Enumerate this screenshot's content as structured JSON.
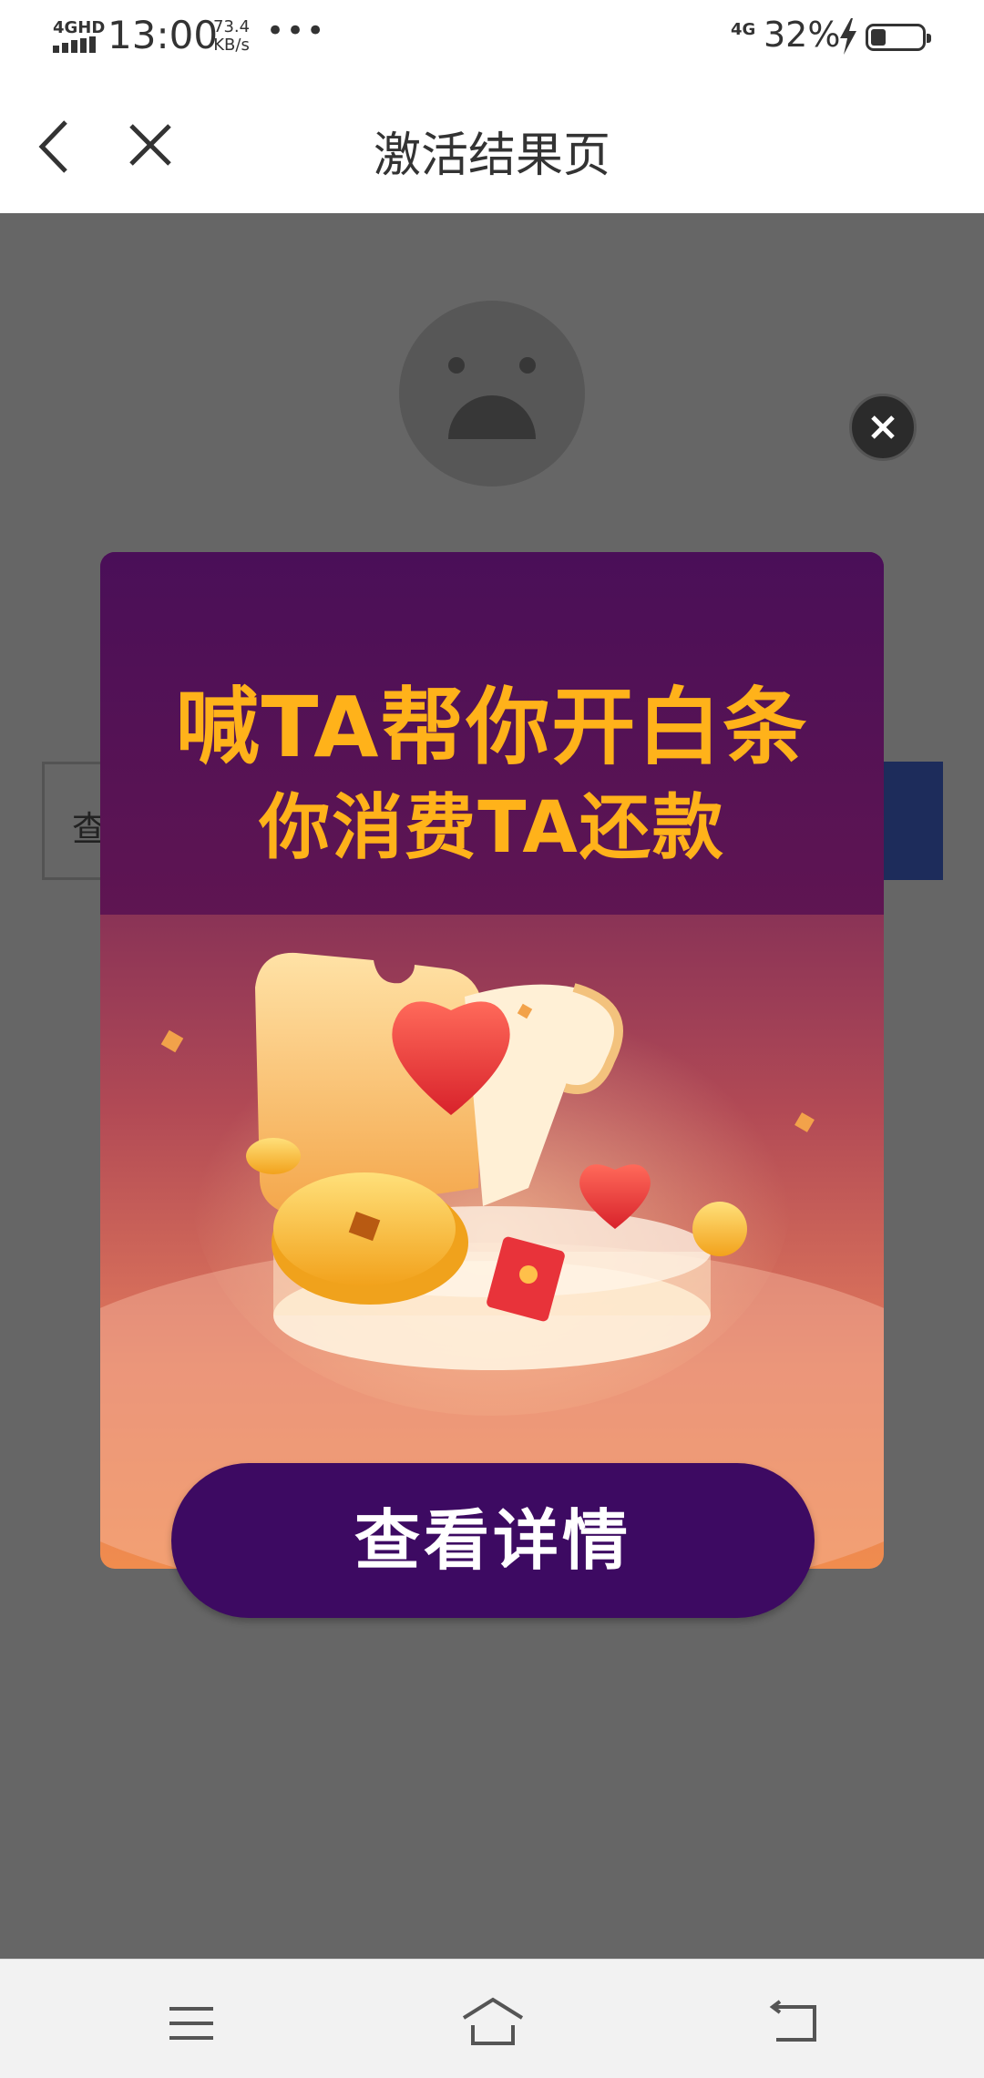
{
  "status_bar": {
    "network": "4GHD",
    "time": "13:00",
    "speed_value": "73.4",
    "speed_unit": "KB/s",
    "more": "•••",
    "network2": "4G",
    "battery": "32%"
  },
  "nav": {
    "title": "激活结果页",
    "back_icon": "chevron-left-icon",
    "close_icon": "close-icon"
  },
  "background_page": {
    "input_text": "查"
  },
  "modal": {
    "headline": "喊TA帮你开白条",
    "subheadline": "你消费TA还款",
    "button_label": "查看详情",
    "colors": {
      "header_purple": "#4a0f58",
      "headline_orange": "#ffb21a",
      "button_purple": "#3d0a62",
      "bottom_orange": "#f08c4e"
    }
  },
  "bottom_nav": {
    "menu_icon": "menu-icon",
    "home_icon": "home-icon",
    "back_icon": "back-icon"
  }
}
